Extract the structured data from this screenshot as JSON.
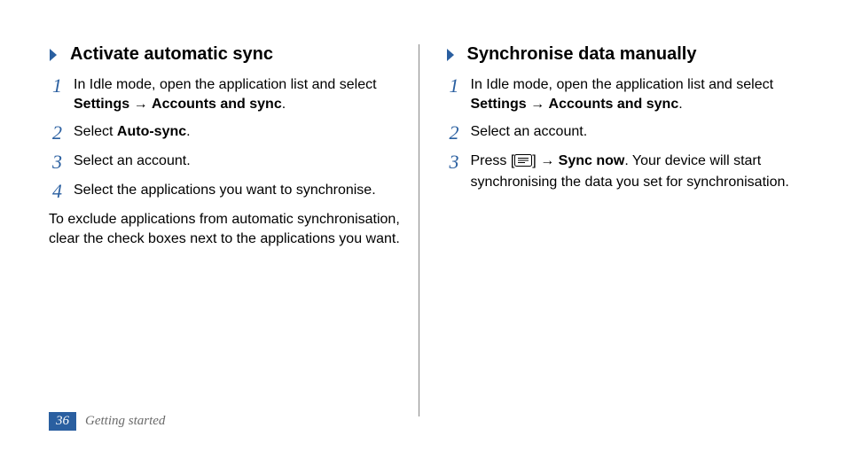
{
  "left": {
    "heading": "Activate automatic sync",
    "steps": [
      {
        "num": "1",
        "pre": "In Idle mode, open the application list and select ",
        "bold1": "Settings",
        "mid": " → ",
        "bold2": "Accounts and sync",
        "post": "."
      },
      {
        "num": "2",
        "pre": "Select ",
        "bold1": "Auto-sync",
        "mid": "",
        "bold2": "",
        "post": "."
      },
      {
        "num": "3",
        "pre": "Select an account.",
        "bold1": "",
        "mid": "",
        "bold2": "",
        "post": ""
      },
      {
        "num": "4",
        "pre": "Select the applications you want to synchronise.",
        "bold1": "",
        "mid": "",
        "bold2": "",
        "post": ""
      }
    ],
    "note": "To exclude applications from automatic synchronisation, clear the check boxes next to the applications you want."
  },
  "right": {
    "heading": "Synchronise data manually",
    "steps": [
      {
        "num": "1",
        "pre": "In Idle mode, open the application list and select ",
        "bold1": "Settings",
        "mid": " → ",
        "bold2": "Accounts and sync",
        "post": "."
      },
      {
        "num": "2",
        "pre": "Select an account.",
        "bold1": "",
        "mid": "",
        "bold2": "",
        "post": ""
      }
    ],
    "step3": {
      "num": "3",
      "pre": "Press [",
      "post_icon": "] → ",
      "bold": "Sync now",
      "tail": ". Your device will start synchronising the data you set for synchronisation."
    }
  },
  "footer": {
    "page": "36",
    "section": "Getting started"
  }
}
